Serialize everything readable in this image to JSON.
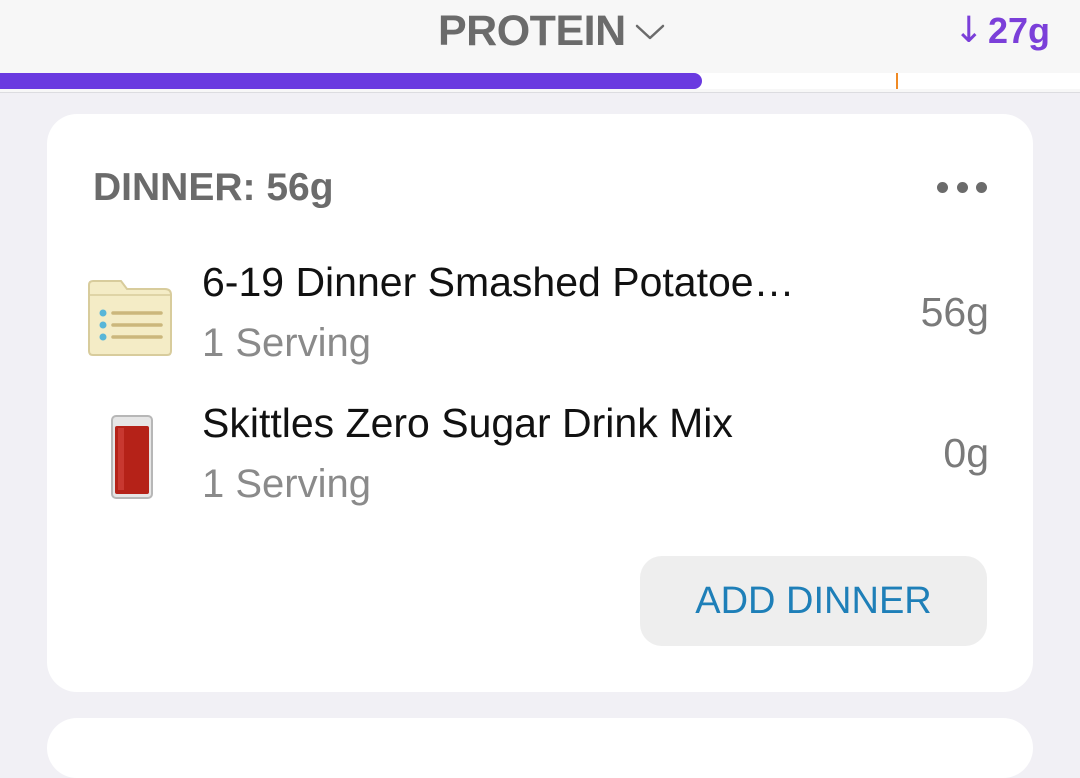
{
  "header": {
    "nutrient": "PROTEIN",
    "remaining_arrow": "↓",
    "remaining_value": "27g",
    "progress_fraction": 0.65,
    "goal_marker_fraction": 0.83,
    "accent_color": "#6a3ae0",
    "remaining_color": "#7b3fd9",
    "goal_marker_color": "#f08a24"
  },
  "meal": {
    "title": "DINNER: 56g",
    "more_icon": "ellipsis-icon",
    "items": [
      {
        "name": "6-19 Dinner Smashed Potatoe…",
        "serving": "1 Serving",
        "amount": "56g",
        "icon": "recipe-folder-icon"
      },
      {
        "name": "Skittles Zero Sugar Drink Mix",
        "serving": "1 Serving",
        "amount": "0g",
        "icon": "drink-glass-icon"
      }
    ],
    "add_button": "ADD DINNER",
    "add_button_color": "#1e7fb8"
  }
}
